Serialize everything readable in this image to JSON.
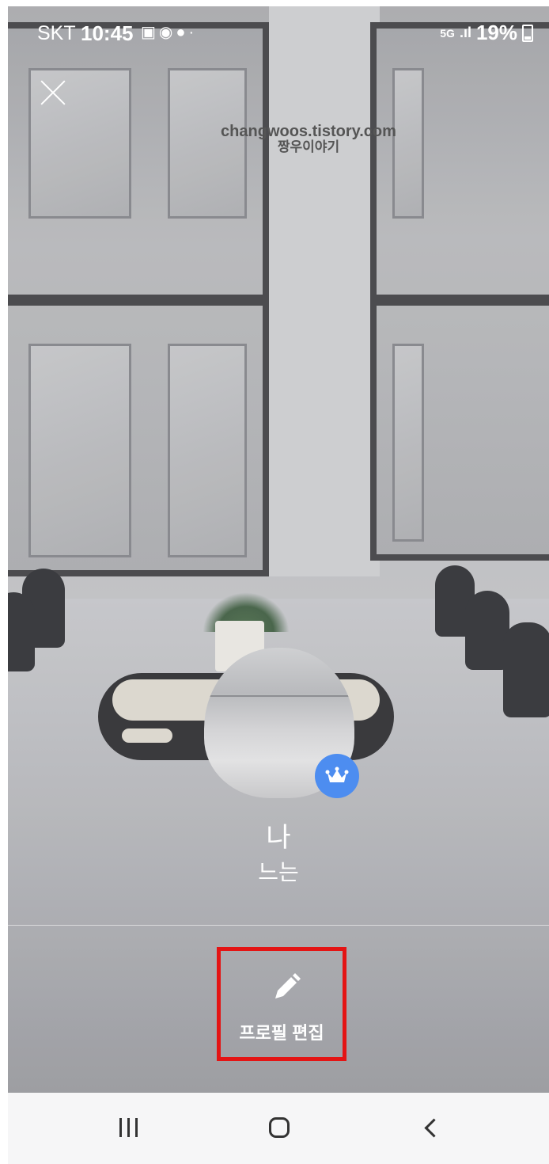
{
  "status_bar": {
    "carrier": "SKT",
    "time": "10:45",
    "notification_icons": [
      "gallery-icon",
      "chat-icon",
      "shopping-bag-icon",
      "dot-icon"
    ],
    "network": "5G",
    "battery": "19%"
  },
  "watermark": {
    "line1": "changwoos.tistory.com",
    "line2": "짱우이야기"
  },
  "profile": {
    "name": "나",
    "status_message": "느는",
    "badge_icon": "crown-icon",
    "badge_color": "#4d8df0"
  },
  "actions": {
    "edit_profile_label": "프로필 편집",
    "edit_profile_icon": "pencil-icon",
    "highlight_color": "#e41414"
  },
  "nav_bar": {
    "recent": "recent-apps-icon",
    "home": "home-icon",
    "back": "back-icon"
  }
}
